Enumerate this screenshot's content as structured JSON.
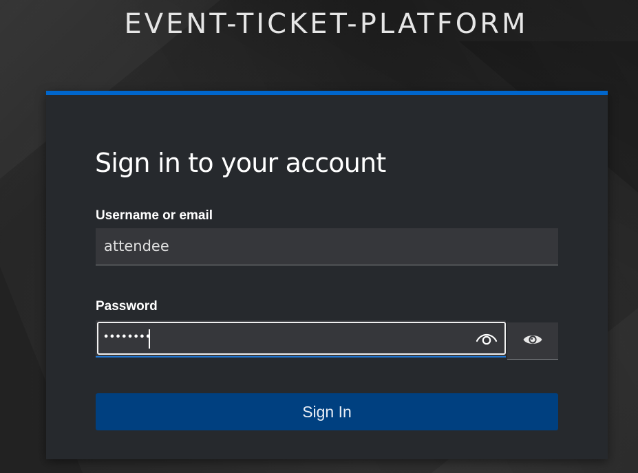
{
  "header": {
    "brand_title": "EVENT-TICKET-PLATFORM"
  },
  "login_form": {
    "heading": "Sign in to your account",
    "username": {
      "label": "Username or email",
      "value": "attendee"
    },
    "password": {
      "label": "Password",
      "masked_value": "••••••••",
      "native_reveal_icon": "eye-outline-icon",
      "toggle_icon": "eye-icon"
    },
    "submit_label": "Sign In"
  },
  "colors": {
    "accent": "#0066cc",
    "primary_button": "#004080",
    "card_background": "#26292d",
    "input_background": "#36373b",
    "page_background": "#262626"
  }
}
